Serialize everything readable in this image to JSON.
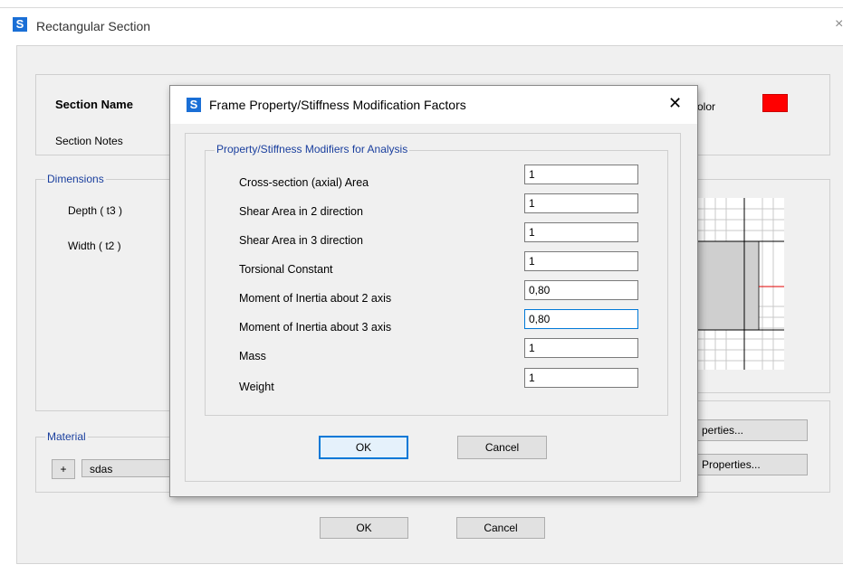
{
  "outer_window": {
    "title": "Rectangular Section",
    "close_glyph": "×",
    "logo_letter": "S",
    "section_name_label": "Section Name",
    "section_notes_label": "Section Notes",
    "color_label_partial": "olor",
    "color_swatch": "#ff0000",
    "dimensions": {
      "title": "Dimensions",
      "depth_label": "Depth  ( t3 )",
      "width_label": "Width  ( t2 )"
    },
    "material": {
      "title": "Material",
      "plus_label": "+",
      "value": "sdas"
    },
    "properties_btn_partial": "perties...",
    "properties2_btn_partial": "Properties...",
    "ok_label": "OK",
    "cancel_label": "Cancel"
  },
  "dialog": {
    "logo_letter": "S",
    "title": "Frame Property/Stiffness Modification Factors",
    "close_glyph": "✕",
    "group_title": "Property/Stiffness Modifiers for Analysis",
    "modifiers": [
      {
        "label": "Cross-section (axial) Area",
        "value": "1"
      },
      {
        "label": "Shear Area in 2 direction",
        "value": "1"
      },
      {
        "label": "Shear Area in 3 direction",
        "value": "1"
      },
      {
        "label": "Torsional Constant",
        "value": "1"
      },
      {
        "label": "Moment of Inertia about 2 axis",
        "value": "0,80"
      },
      {
        "label": "Moment of Inertia about 3 axis",
        "value": "0,80"
      },
      {
        "label": "Mass",
        "value": "1"
      },
      {
        "label": "Weight",
        "value": "1"
      }
    ],
    "ok_label": "OK",
    "cancel_label": "Cancel"
  }
}
